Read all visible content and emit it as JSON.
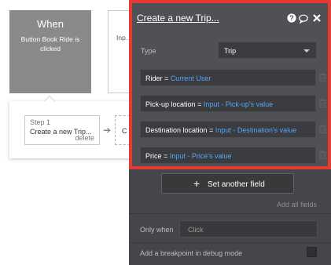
{
  "canvas": {
    "event": {
      "title": "When",
      "subtitle": "Button Book Ride is clicked"
    },
    "event2": {
      "partial_text": "Inp… va…"
    },
    "step": {
      "number": "Step 1",
      "name": "Create a new Trip...",
      "delete": "delete",
      "next_partial": "C"
    }
  },
  "panel": {
    "title": "Create a new Trip...",
    "type_label": "Type",
    "type_value": "Trip",
    "fields": [
      {
        "label": "Rider",
        "eq": "=",
        "value": "Current User"
      },
      {
        "label": "Pick-up location",
        "eq": "=",
        "value": "Input - Pick-up's value"
      },
      {
        "label": "Destination location",
        "eq": "=",
        "value": "Input - Destination's value"
      },
      {
        "label": "Price",
        "eq": "=",
        "value": "Input - Price's value"
      }
    ],
    "set_field_label": "Set another field",
    "add_all_label": "Add all fields",
    "only_when_label": "Only when",
    "only_when_placeholder": "Click",
    "debug_label": "Add a breakpoint in debug mode"
  },
  "colors": {
    "highlight_border": "#e83a33",
    "link_blue": "#59a3f5",
    "panel_bg": "#444649"
  },
  "icons": [
    "help-icon",
    "chat-icon",
    "close-icon",
    "trash-icon",
    "plus-icon",
    "arrow-icon"
  ]
}
